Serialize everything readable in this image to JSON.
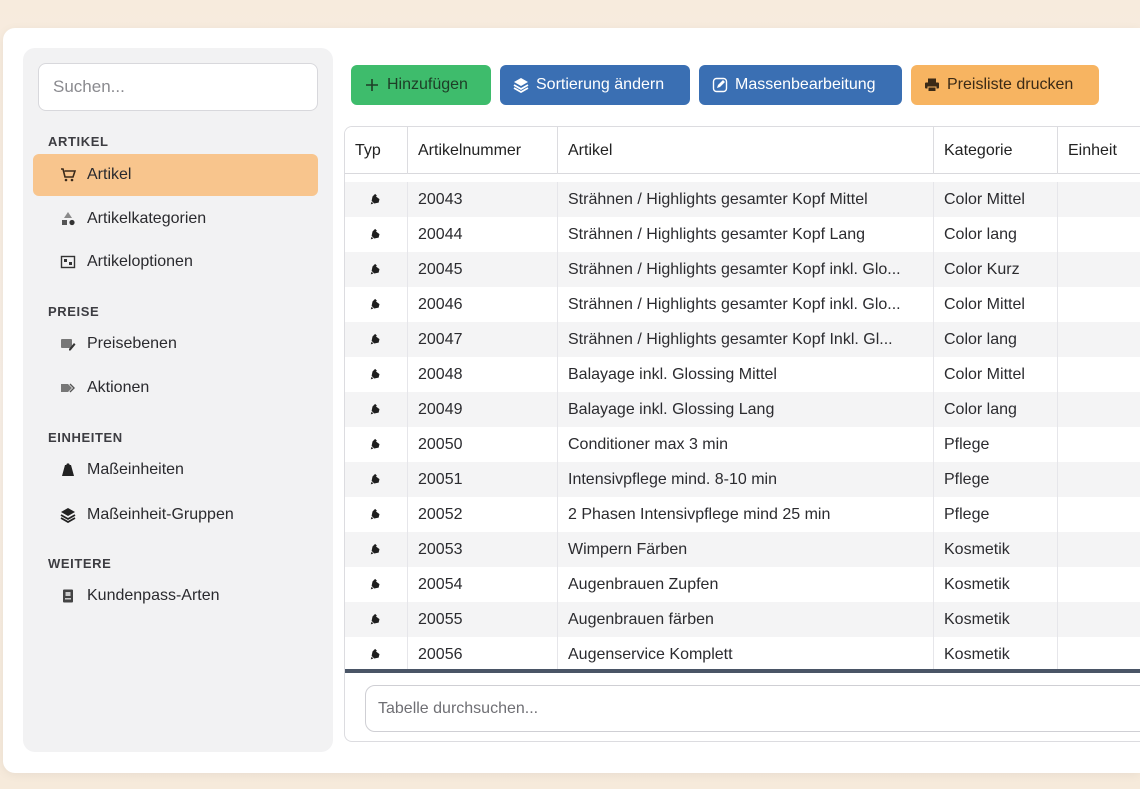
{
  "sidebar": {
    "search_placeholder": "Suchen...",
    "sections": [
      {
        "title": "ARTIKEL",
        "items": [
          "Artikel",
          "Artikelkategorien",
          "Artikeloptionen"
        ]
      },
      {
        "title": "PREISE",
        "items": [
          "Preisebenen",
          "Aktionen"
        ]
      },
      {
        "title": "EINHEITEN",
        "items": [
          "Maßeinheiten",
          "Maßeinheit-Gruppen"
        ]
      },
      {
        "title": "WEITERE",
        "items": [
          "Kundenpass-Arten"
        ]
      }
    ],
    "active_item": "Artikel"
  },
  "toolbar": {
    "add_label": "Hinzufügen",
    "sort_label": "Sortierung ändern",
    "mass_label": "Massenbearbeitung",
    "print_label": "Preisliste drucken"
  },
  "table": {
    "headers": [
      "Typ",
      "Artikelnummer",
      "Artikel",
      "Kategorie",
      "Einheit"
    ],
    "rows": [
      {
        "num": "20043",
        "article": "Strähnen / Highlights gesamter Kopf Mittel",
        "category": "Color Mittel"
      },
      {
        "num": "20044",
        "article": "Strähnen / Highlights gesamter Kopf Lang",
        "category": "Color lang"
      },
      {
        "num": "20045",
        "article": "Strähnen / Highlights gesamter Kopf inkl. Glo...",
        "category": "Color Kurz"
      },
      {
        "num": "20046",
        "article": "Strähnen / Highlights gesamter Kopf inkl. Glo...",
        "category": "Color Mittel"
      },
      {
        "num": "20047",
        "article": "Strähnen / Highlights gesamter Kopf Inkl. Gl...",
        "category": "Color lang"
      },
      {
        "num": "20048",
        "article": "Balayage inkl. Glossing Mittel",
        "category": "Color Mittel"
      },
      {
        "num": "20049",
        "article": "Balayage inkl. Glossing Lang",
        "category": "Color lang"
      },
      {
        "num": "20050",
        "article": "Conditioner max 3 min",
        "category": "Pflege"
      },
      {
        "num": "20051",
        "article": "Intensivpflege mind. 8-10 min",
        "category": "Pflege"
      },
      {
        "num": "20052",
        "article": "2 Phasen Intensivpflege mind 25 min",
        "category": "Pflege"
      },
      {
        "num": "20053",
        "article": "Wimpern Färben",
        "category": "Kosmetik"
      },
      {
        "num": "20054",
        "article": "Augenbrauen Zupfen",
        "category": "Kosmetik"
      },
      {
        "num": "20055",
        "article": "Augenbrauen färben",
        "category": "Kosmetik"
      },
      {
        "num": "20056",
        "article": "Augenservice Komplett",
        "category": "Kosmetik"
      }
    ],
    "search_placeholder": "Tabelle durchsuchen..."
  },
  "colors": {
    "active_nav": "#f8c58d",
    "add_button": "#3ebc6c",
    "blue_button": "#3a6fb3",
    "print_button": "#f7b461"
  }
}
